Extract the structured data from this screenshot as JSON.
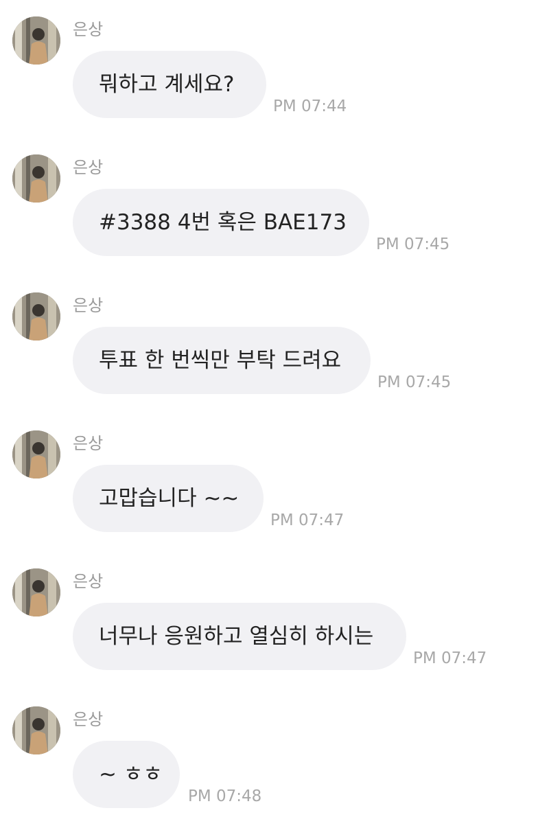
{
  "messages": [
    {
      "sender": "은상",
      "text": "뭐하고 계세요?",
      "time": "PM 07:44"
    },
    {
      "sender": "은상",
      "text": "#3388 4번 혹은 BAE173",
      "time": "PM 07:45"
    },
    {
      "sender": "은상",
      "text": "투표 한 번씩만 부탁 드려요",
      "time": "PM 07:45"
    },
    {
      "sender": "은상",
      "text": "고맙습니다 ~~",
      "time": "PM 07:47"
    },
    {
      "sender": "은상",
      "text": "너무나 응원하고 열심히 하시는",
      "time": "PM 07:47"
    },
    {
      "sender": "은상",
      "text": "~ ㅎㅎ",
      "time": "PM 07:48"
    }
  ],
  "colors": {
    "bubble": "#f1f1f4",
    "text": "#222222",
    "meta": "#a8a8a8"
  }
}
